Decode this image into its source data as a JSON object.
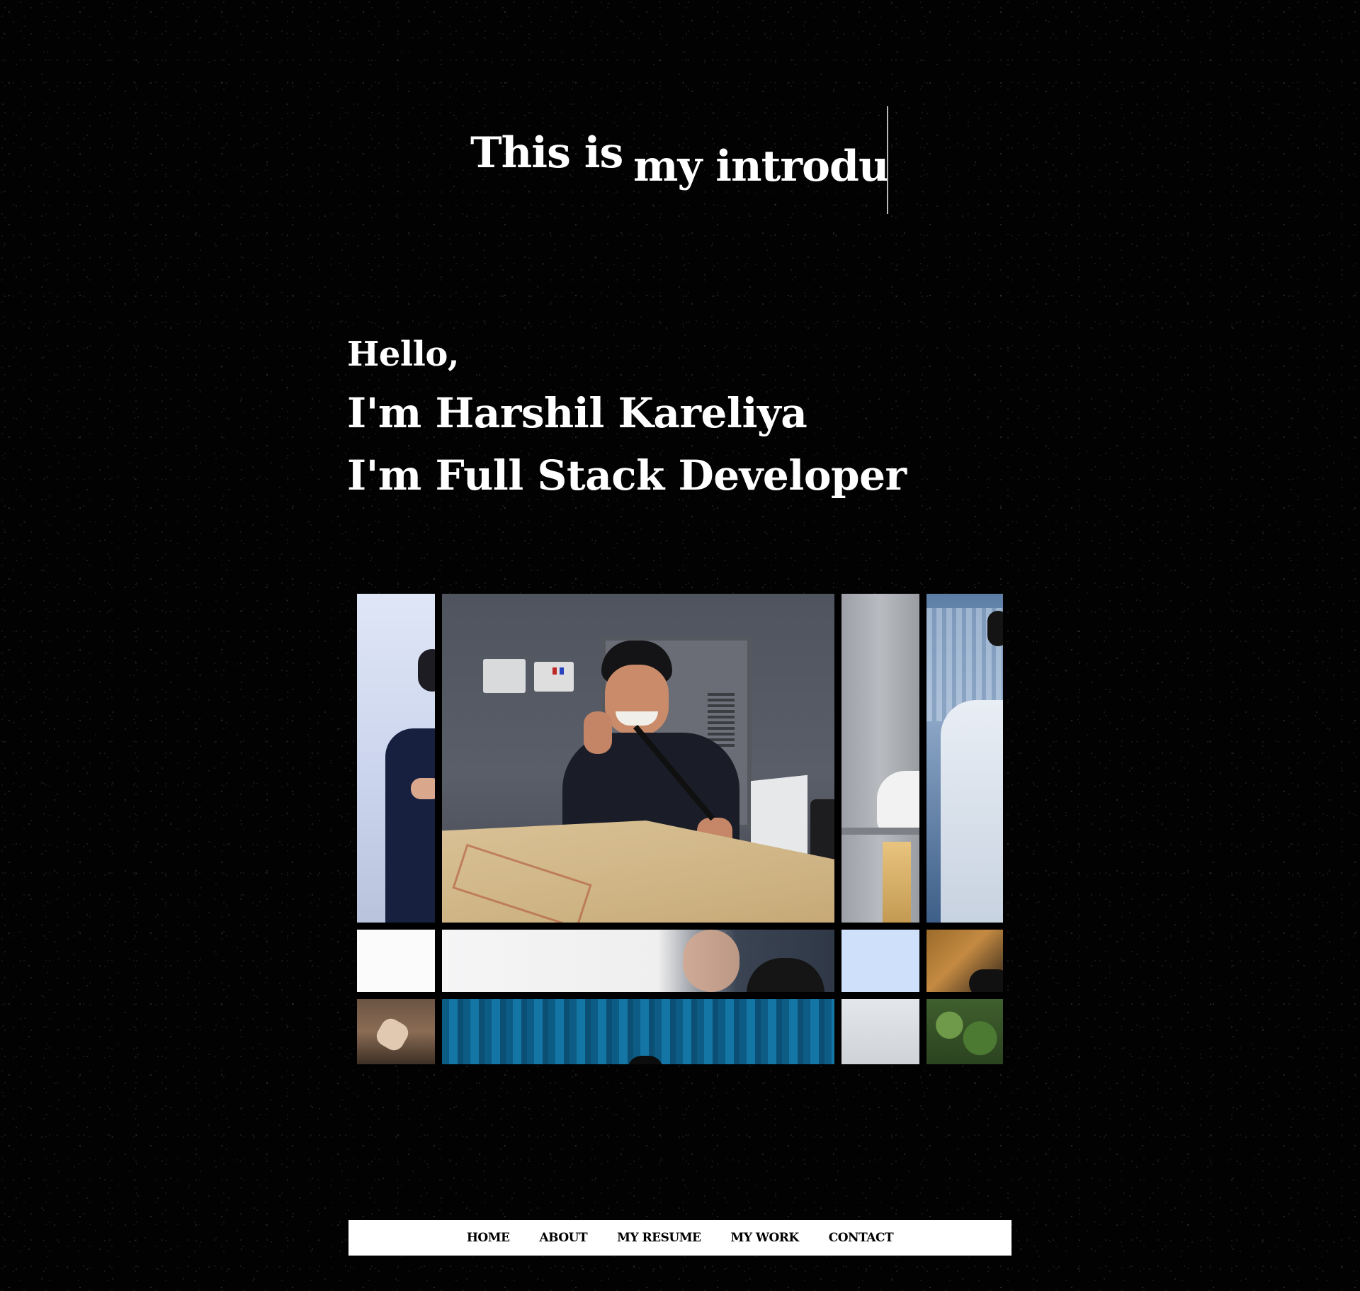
{
  "intro": {
    "part1": "This is",
    "part2": "my introdu"
  },
  "hero": {
    "greeting": "Hello,",
    "name_line": "I'm Harshil Kareliya",
    "role_line": "I'm Full Stack Developer"
  },
  "gallery": {
    "photos": [
      "photo-person-blue-shirt",
      "photo-speaker-at-podium",
      "photo-person-doorway",
      "photo-person-white-shirt",
      "photo-white-backdrop",
      "photo-closeup-face",
      "photo-light-blue",
      "photo-warm-light",
      "photo-brown-detail",
      "photo-blue-curtain",
      "photo-light-grey",
      "photo-green-trees"
    ]
  },
  "nav": {
    "items": [
      "HOME",
      "ABOUT",
      "MY RESUME",
      "MY WORK",
      "CONTACT"
    ]
  },
  "colors": {
    "background": "#000000",
    "text": "#ffffff",
    "nav_background": "#ffffff",
    "nav_text": "#000000"
  }
}
